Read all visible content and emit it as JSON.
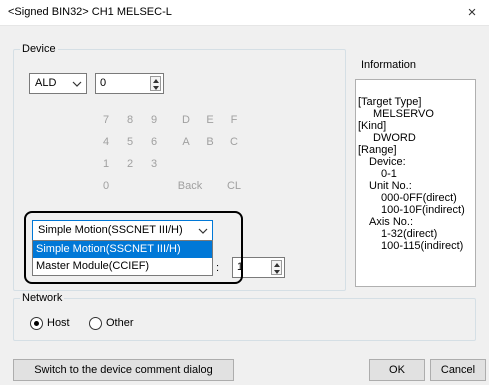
{
  "window": {
    "title": "<Signed BIN32> CH1 MELSEC-L",
    "close_glyph": "×"
  },
  "device": {
    "group_label": "Device",
    "type_value": "ALD",
    "number_value": "0",
    "keypad": [
      "7",
      "8",
      "9",
      "D",
      "E",
      "F",
      "4",
      "5",
      "6",
      "A",
      "B",
      "C",
      "1",
      "2",
      "3",
      "0",
      "Back",
      "CL"
    ]
  },
  "information": {
    "label": "Information",
    "lines": [
      "[Target Type]",
      "MELSERVO",
      "[Kind]",
      "DWORD",
      "[Range]",
      "Device:",
      "0-1",
      "Unit No.:",
      "000-0FF(direct)",
      "100-10F(indirect)",
      "Axis No.:",
      "1-32(direct)",
      "100-115(indirect)"
    ]
  },
  "module_select": {
    "selected": "Simple Motion(SSCNET III/H)",
    "options": [
      "Simple Motion(SSCNET III/H)",
      "Master Module(CCIEF)"
    ],
    "partial_label": ":",
    "axis_value": "1"
  },
  "network": {
    "group_label": "Network",
    "options": [
      "Host",
      "Other"
    ],
    "selected": "Host"
  },
  "buttons": {
    "switch_comment": "Switch to the device comment dialog",
    "ok": "OK",
    "cancel": "Cancel"
  }
}
